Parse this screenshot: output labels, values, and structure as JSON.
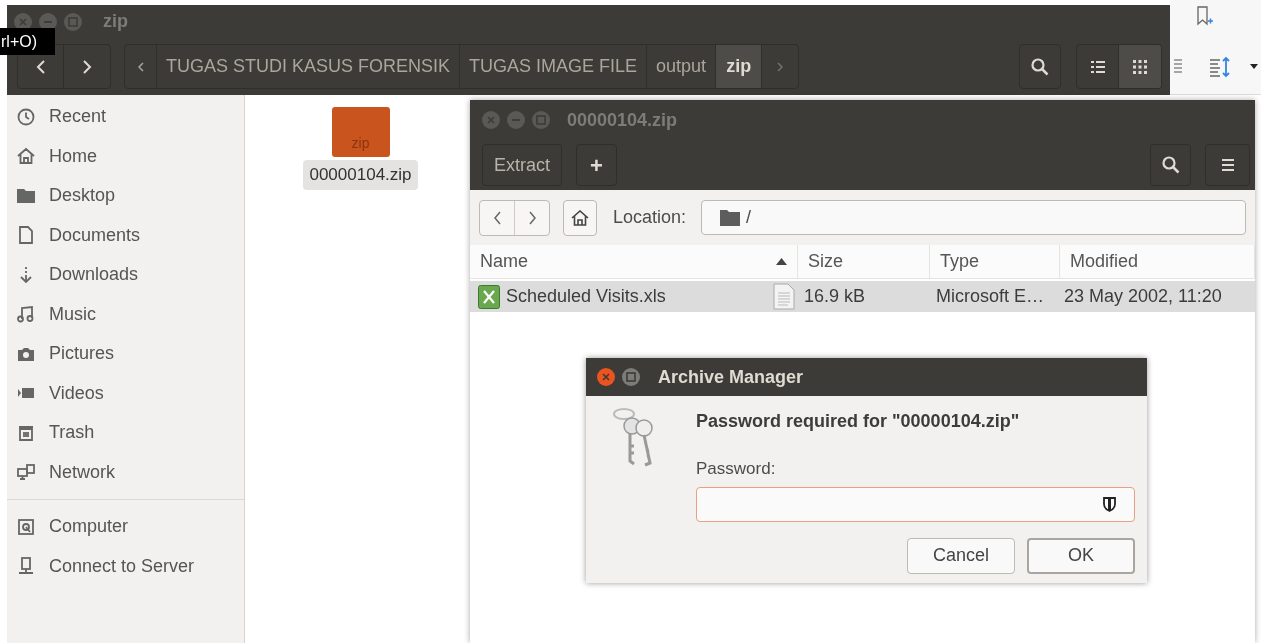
{
  "file_manager": {
    "title": "zip",
    "tooltip": "rl+O)",
    "path": [
      {
        "label": "TUGAS STUDI KASUS FORENSIK",
        "selected": false
      },
      {
        "label": "TUGAS IMAGE FILE",
        "selected": false
      },
      {
        "label": "output",
        "selected": false
      },
      {
        "label": "zip",
        "selected": true
      }
    ],
    "view_modes": [
      {
        "kind": "list",
        "selected": false
      },
      {
        "kind": "grid",
        "selected": true
      }
    ],
    "sidebar": [
      {
        "items": [
          {
            "kind": "recent",
            "label": "Recent"
          },
          {
            "kind": "home",
            "label": "Home"
          },
          {
            "kind": "desktop",
            "label": "Desktop"
          },
          {
            "kind": "documents",
            "label": "Documents"
          },
          {
            "kind": "downloads",
            "label": "Downloads"
          },
          {
            "kind": "music",
            "label": "Music"
          },
          {
            "kind": "pictures",
            "label": "Pictures"
          },
          {
            "kind": "videos",
            "label": "Videos"
          },
          {
            "kind": "trash",
            "label": "Trash"
          },
          {
            "kind": "network",
            "label": "Network"
          }
        ]
      },
      {
        "items": [
          {
            "kind": "computer",
            "label": "Computer"
          },
          {
            "kind": "server",
            "label": "Connect to Server"
          }
        ]
      }
    ],
    "files": [
      {
        "name": "00000104.zip",
        "icon_label": "zip",
        "selected": true
      }
    ]
  },
  "archive_manager": {
    "title": "00000104.zip",
    "extract": "Extract",
    "add": "+",
    "location_label": "Location:",
    "location": "/",
    "columns": [
      {
        "label": "Name",
        "sorted": true
      },
      {
        "label": "Size",
        "sorted": false
      },
      {
        "label": "Type",
        "sorted": false
      },
      {
        "label": "Modified",
        "sorted": false
      }
    ],
    "rows": [
      {
        "name": "Scheduled Visits.xls",
        "size": "16.9 kB",
        "type": "Microsoft E…",
        "modified": "23 May 2002, 11:20",
        "selected": true
      }
    ]
  },
  "dialog": {
    "title": "Archive Manager",
    "heading": "Password required for \"00000104.zip\"",
    "field_label": "Password:",
    "buttons": [
      {
        "label": "Cancel",
        "default": false
      },
      {
        "label": "OK",
        "default": true
      }
    ]
  }
}
